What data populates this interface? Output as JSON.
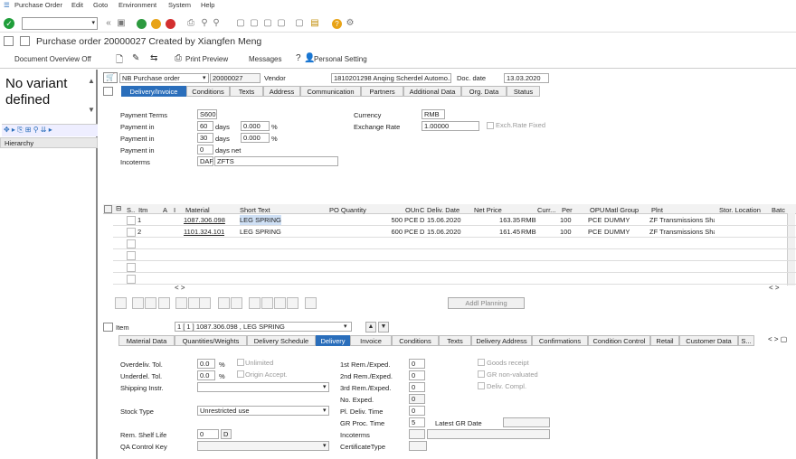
{
  "menu": [
    "Purchase Order",
    "Edit",
    "Goto",
    "Environment",
    "System",
    "Help"
  ],
  "title": "Purchase order 20000027 Created by Xiangfen Meng",
  "app_toolbar": {
    "overview": "Document Overview Off",
    "print": "Print Preview",
    "messages": "Messages",
    "personal": "Personal Setting"
  },
  "left": {
    "no_variant": "No variant defined",
    "hierarchy": "Hierarchy"
  },
  "header": {
    "doctype": "NB Purchase order",
    "po_number": "20000027",
    "vendor_label": "Vendor",
    "vendor": "1810201298 Anqing Scherdel Automo...",
    "docdate_label": "Doc. date",
    "docdate": "13.03.2020",
    "tabs": [
      "Delivery/Invoice",
      "Conditions",
      "Texts",
      "Address",
      "Communication",
      "Partners",
      "Additional Data",
      "Org. Data",
      "Status"
    ],
    "payment_terms_label": "Payment Terms",
    "payment_terms": "S600",
    "payment_in_label": "Payment in",
    "pay1_days": "60",
    "pay1_pct": "0.000",
    "pay2_days": "30",
    "pay2_pct": "0.000",
    "pay3_days": "0",
    "days": "days",
    "days_net": "days net",
    "pct": "%",
    "incoterms_label": "Incoterms",
    "incoterms": "DAP",
    "incoterms2": "ZFTS",
    "currency_label": "Currency",
    "currency": "RMB",
    "exrate_label": "Exchange Rate",
    "exrate": "1.00000",
    "exrate_fixed": "Exch.Rate Fixed"
  },
  "items_grid": {
    "headers": [
      "S..",
      "Itm",
      "A",
      "I",
      "Material",
      "Short Text",
      "PO Quantity",
      "OUn",
      "C",
      "Deliv. Date",
      "Net Price",
      "Curr...",
      "Per",
      "OPU",
      "Matl Group",
      "Plnt",
      "Stor. Location",
      "Batc"
    ],
    "rows": [
      {
        "itm": "1",
        "material": "1087.306.098",
        "text": "LEG SPRING",
        "qty": "500",
        "oun": "PCE",
        "c": "D",
        "date": "15.06.2020",
        "price": "163.35",
        "curr": "RMB",
        "per": "100",
        "opu": "PCE",
        "group": "DUMMY",
        "plnt": "ZF Transmissions Sha..."
      },
      {
        "itm": "2",
        "material": "1101.324.101",
        "text": "LEG SPRING",
        "qty": "600",
        "oun": "PCE",
        "c": "D",
        "date": "15.06.2020",
        "price": "161.45",
        "curr": "RMB",
        "per": "100",
        "opu": "PCE",
        "group": "DUMMY",
        "plnt": "ZF Transmissions Sha..."
      }
    ],
    "addl_planning": "Addl Planning"
  },
  "item_detail": {
    "item_label": "Item",
    "item_value": "1 [ 1 ] 1087.306.098 , LEG SPRING",
    "tabs": [
      "Material Data",
      "Quantities/Weights",
      "Delivery Schedule",
      "Delivery",
      "Invoice",
      "Conditions",
      "Texts",
      "Delivery Address",
      "Confirmations",
      "Condition Control",
      "Retail",
      "Customer Data",
      "S..."
    ],
    "overdeliv_label": "Overdeliv. Tol.",
    "overdeliv": "0.0",
    "underdel_label": "Underdel. Tol.",
    "underdel": "0.0",
    "pct": "%",
    "unlimited": "Unlimited",
    "orig_accept": "Origin Accept.",
    "shipping_label": "Shipping Instr.",
    "stock_type_label": "Stock Type",
    "stock_type": "Unrestricted use",
    "shelf_life_label": "Rem. Shelf Life",
    "shelf_life": "0",
    "shelf_unit": "D",
    "qa_label": "QA Control Key",
    "rem1_label": "1st Rem./Exped.",
    "rem1": "0",
    "rem2_label": "2nd Rem./Exped.",
    "rem2": "0",
    "rem3_label": "3rd Rem./Exped.",
    "rem3": "0",
    "noexp_label": "No. Exped.",
    "noexp": "0",
    "pldeliv_label": "Pl. Deliv. Time",
    "pldeliv": "0",
    "grproc_label": "GR Proc. Time",
    "grproc": "5",
    "latest_gr_label": "Latest GR Date",
    "incoterms_label": "Incoterms",
    "cert_label": "CertificateType",
    "goods_receipt": "Goods receipt",
    "gr_nonval": "GR non-valuated",
    "deliv_compl": "Deliv. Compl."
  }
}
